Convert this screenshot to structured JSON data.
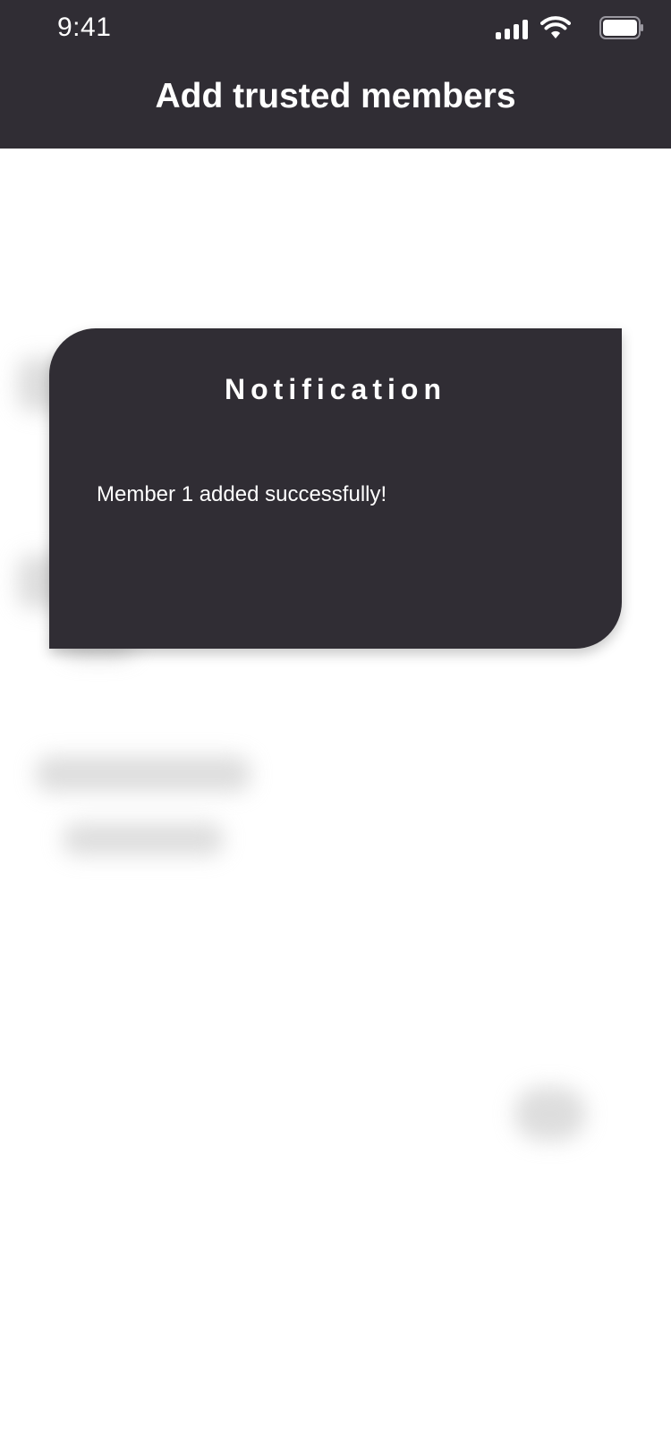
{
  "status_bar": {
    "time": "9:41",
    "icons": [
      "signal-icon",
      "wifi-icon",
      "battery-icon"
    ]
  },
  "header": {
    "title": "Add trusted members"
  },
  "dialog": {
    "title": "Notification",
    "message": "Member 1 added successfully!"
  },
  "colors": {
    "header_bg": "#302d34",
    "dialog_bg": "#302d34",
    "text": "#ffffff",
    "background": "#ffffff"
  }
}
